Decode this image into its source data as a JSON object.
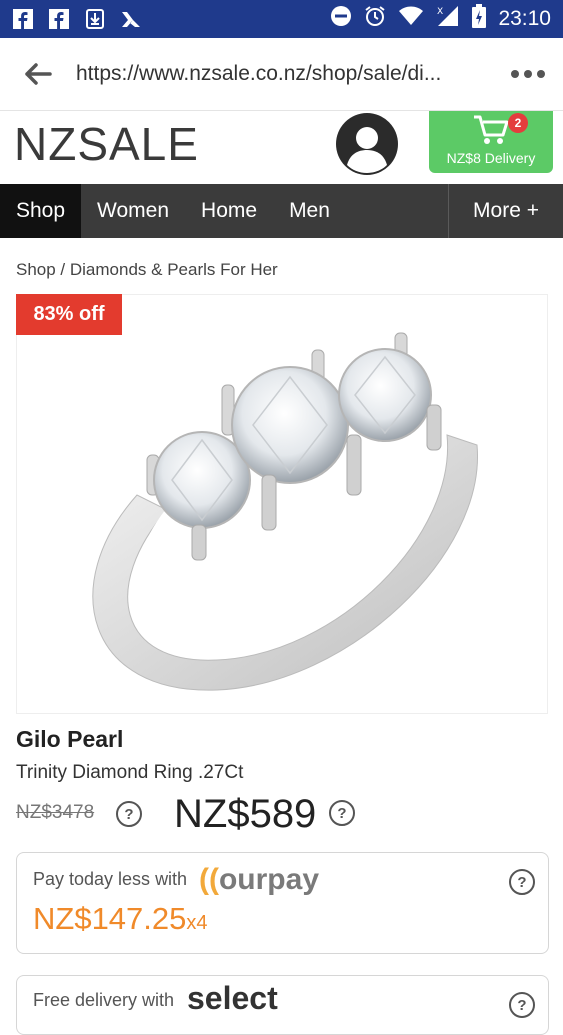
{
  "status_bar": {
    "time": "23:10",
    "icons": [
      "facebook-icon",
      "facebook-icon",
      "download-icon",
      "check-icon",
      "dnd-icon",
      "alarm-icon",
      "wifi-icon",
      "signal-icon",
      "battery-icon"
    ]
  },
  "browser": {
    "url": "https://www.nzsale.co.nz/shop/sale/di..."
  },
  "header": {
    "logo": "NZSALE",
    "cart_count": "2",
    "cart_label": "NZ$8 Delivery",
    "cart_color": "#5cca66"
  },
  "nav": {
    "items": [
      "Shop",
      "Women",
      "Home",
      "Men"
    ],
    "more": "More +"
  },
  "breadcrumb": "Shop / Diamonds & Pearls For Her",
  "product": {
    "discount": "83% off",
    "brand": "Gilo Pearl",
    "name": "Trinity Diamond Ring .27Ct",
    "old_price": "NZ$3478",
    "price": "NZ$589"
  },
  "ourpay": {
    "text": "Pay today less with",
    "logo": "ourpay",
    "amount": "NZ$147.25",
    "multiplier": "x4"
  },
  "delivery": {
    "text": "Free delivery with",
    "logo": "select"
  },
  "colors": {
    "status_bar": "#1f3a8c",
    "nav_bg": "#3b3b3b",
    "discount": "#e33b2e",
    "pay_amount": "#f08a2a"
  }
}
